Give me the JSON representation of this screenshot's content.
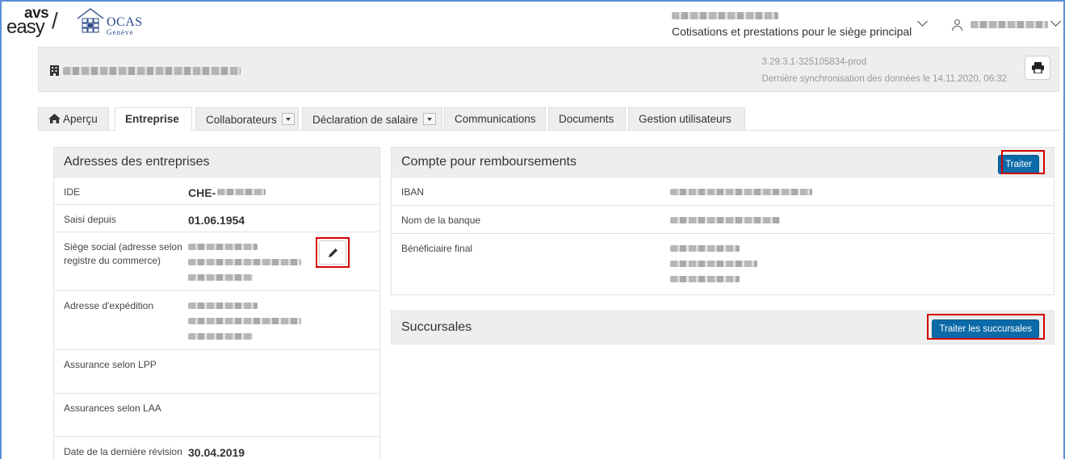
{
  "header": {
    "logo_avs": "avs",
    "logo_easy": "easy",
    "org_logo_name": "OCAS",
    "org_logo_sub": "Genève",
    "context_label": "Cotisations et prestations pour le siège principal"
  },
  "banner": {
    "version": "3.29.3.1-325105834-prod",
    "sync": "Dernière synchronisation des données le 14.11.2020, 06:32"
  },
  "tabs": [
    {
      "label": "Aperçu"
    },
    {
      "label": "Entreprise"
    },
    {
      "label": "Collaborateurs"
    },
    {
      "label": "Déclaration de salaire"
    },
    {
      "label": "Communications"
    },
    {
      "label": "Documents"
    },
    {
      "label": "Gestion utilisateurs"
    }
  ],
  "addresses": {
    "title": "Adresses des entreprises",
    "rows": [
      {
        "label": "IDE",
        "value": "CHE-"
      },
      {
        "label": "Saisi depuis",
        "value": "01.06.1954"
      },
      {
        "label": "Siège social (adresse selon registre du commerce)"
      },
      {
        "label": "Adresse d'expédition"
      },
      {
        "label": "Assurance selon LPP"
      },
      {
        "label": "Assurances selon LAA"
      },
      {
        "label": "Date de la dernière révision",
        "value": "30.04.2019"
      }
    ]
  },
  "refunds": {
    "title": "Compte pour remboursements",
    "button": "Traiter",
    "rows": [
      {
        "label": "IBAN"
      },
      {
        "label": "Nom de la banque"
      },
      {
        "label": "Bénéficiaire final"
      }
    ]
  },
  "branches": {
    "title": "Succursales",
    "button": "Traiter les succursales"
  },
  "colors": {
    "primary": "#0b6aa8",
    "highlight": "#d40000",
    "frame": "#5b8ed6"
  }
}
